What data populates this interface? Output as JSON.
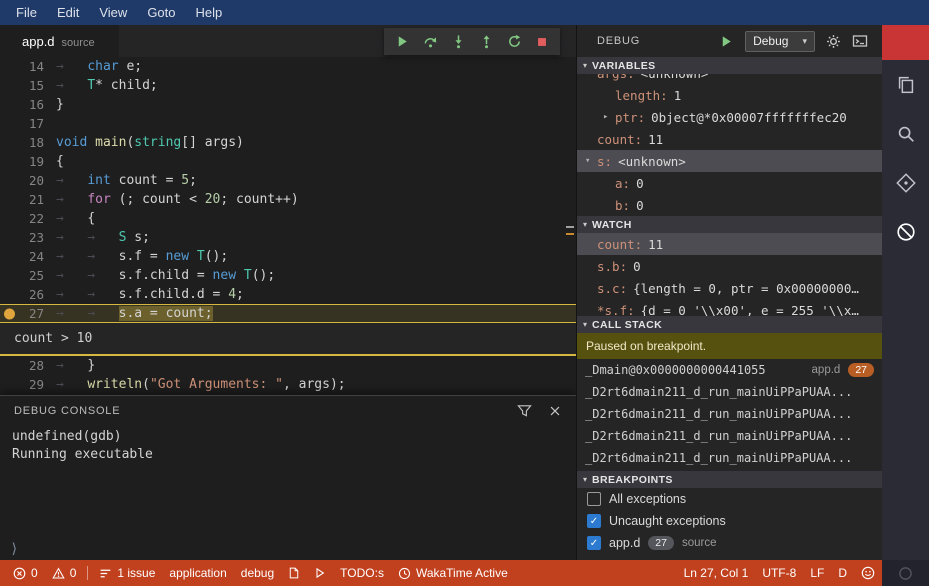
{
  "colors": {
    "menu_bg": "#1f3a68",
    "status_bg": "#c1411f",
    "activity_red": "#c93434",
    "green": "#82c882",
    "red": "#e25d5d",
    "cl_border": "#d4b840",
    "bp_yellow": "#e0a53c",
    "badge_orange": "#b85d24",
    "banner_bg": "#575110",
    "check_blue": "#2d7ad1",
    "sel_bg": "#4c4c52"
  },
  "glyphs": {
    "chevron_down": "▾",
    "twistie_open": "▾",
    "twistie_closed": "▸",
    "check": "✓"
  },
  "menubar": {
    "items": [
      {
        "label": "File"
      },
      {
        "label": "Edit"
      },
      {
        "label": "View"
      },
      {
        "label": "Goto"
      },
      {
        "label": "Help"
      }
    ]
  },
  "editor": {
    "tab": {
      "title": "app.d",
      "subtitle": "source"
    },
    "toolbar": [
      {
        "name": "continue-button",
        "icon": "continue-icon"
      },
      {
        "name": "step-over-button",
        "icon": "step-over-icon"
      },
      {
        "name": "step-into-button",
        "icon": "step-into-icon"
      },
      {
        "name": "step-out-button",
        "icon": "step-out-icon"
      },
      {
        "name": "restart-button",
        "icon": "restart-icon"
      },
      {
        "name": "stop-button",
        "icon": "stop-icon"
      }
    ],
    "breakpoint_widget_text": "count > 10",
    "lines": [
      {
        "n": "14",
        "tokens": [
          {
            "c": "ws",
            "t": "→   "
          },
          {
            "c": "kw",
            "t": "char"
          },
          {
            "c": "d",
            "t": " e;"
          }
        ]
      },
      {
        "n": "15",
        "tokens": [
          {
            "c": "ws",
            "t": "→   "
          },
          {
            "c": "ty",
            "t": "T"
          },
          {
            "c": "d",
            "t": "* child;"
          }
        ]
      },
      {
        "n": "16",
        "tokens": [
          {
            "c": "d",
            "t": "}"
          }
        ]
      },
      {
        "n": "17",
        "tokens": []
      },
      {
        "n": "18",
        "tokens": [
          {
            "c": "kw",
            "t": "void"
          },
          {
            "c": "d",
            "t": " "
          },
          {
            "c": "fn",
            "t": "main"
          },
          {
            "c": "d",
            "t": "("
          },
          {
            "c": "ty",
            "t": "string"
          },
          {
            "c": "d",
            "t": "[] args)"
          }
        ]
      },
      {
        "n": "19",
        "tokens": [
          {
            "c": "d",
            "t": "{"
          }
        ]
      },
      {
        "n": "20",
        "tokens": [
          {
            "c": "ws",
            "t": "→   "
          },
          {
            "c": "kw",
            "t": "int"
          },
          {
            "c": "d",
            "t": " count = "
          },
          {
            "c": "num",
            "t": "5"
          },
          {
            "c": "d",
            "t": ";"
          }
        ]
      },
      {
        "n": "21",
        "tokens": [
          {
            "c": "ws",
            "t": "→   "
          },
          {
            "c": "ctrl",
            "t": "for"
          },
          {
            "c": "d",
            "t": " (; count < "
          },
          {
            "c": "num",
            "t": "20"
          },
          {
            "c": "d",
            "t": "; count++)"
          }
        ]
      },
      {
        "n": "22",
        "tokens": [
          {
            "c": "ws",
            "t": "→   "
          },
          {
            "c": "d",
            "t": "{"
          }
        ]
      },
      {
        "n": "23",
        "tokens": [
          {
            "c": "ws",
            "t": "→   →   "
          },
          {
            "c": "ty",
            "t": "S"
          },
          {
            "c": "d",
            "t": " s;"
          }
        ]
      },
      {
        "n": "24",
        "tokens": [
          {
            "c": "ws",
            "t": "→   →   "
          },
          {
            "c": "d",
            "t": "s.f = "
          },
          {
            "c": "kw",
            "t": "new"
          },
          {
            "c": "d",
            "t": " "
          },
          {
            "c": "ty",
            "t": "T"
          },
          {
            "c": "d",
            "t": "();"
          }
        ]
      },
      {
        "n": "25",
        "tokens": [
          {
            "c": "ws",
            "t": "→   →   "
          },
          {
            "c": "d",
            "t": "s.f.child = "
          },
          {
            "c": "kw",
            "t": "new"
          },
          {
            "c": "d",
            "t": " "
          },
          {
            "c": "ty",
            "t": "T"
          },
          {
            "c": "d",
            "t": "();"
          }
        ]
      },
      {
        "n": "26",
        "tokens": [
          {
            "c": "ws",
            "t": "→   →   "
          },
          {
            "c": "d",
            "t": "s.f.child.d = "
          },
          {
            "c": "num",
            "t": "4"
          },
          {
            "c": "d",
            "t": ";"
          }
        ]
      },
      {
        "n": "27",
        "current": true,
        "breakpoint": true,
        "widget": true,
        "tokens": [
          {
            "c": "ws",
            "t": "→   →   "
          },
          {
            "c": "d",
            "t": "s.a = count;",
            "hl": true
          }
        ]
      },
      {
        "n": "28",
        "tokens": [
          {
            "c": "ws",
            "t": "→   "
          },
          {
            "c": "d",
            "t": "}"
          }
        ]
      },
      {
        "n": "29",
        "tokens": [
          {
            "c": "ws",
            "t": "→   "
          },
          {
            "c": "fn",
            "t": "writeln"
          },
          {
            "c": "d",
            "t": "("
          },
          {
            "c": "str",
            "t": "\"Got Arguments: \""
          },
          {
            "c": "d",
            "t": ", args);"
          }
        ]
      }
    ]
  },
  "debug_console": {
    "title": "DEBUG CONSOLE",
    "lines": [
      "undefined(gdb)",
      "Running executable"
    ],
    "prompt": "⟩"
  },
  "debug_panel": {
    "title": "DEBUG",
    "config": "Debug",
    "variables": {
      "title": "VARIABLES",
      "rows": [
        {
          "label": "args",
          "value": "<unknown>",
          "indent": 1,
          "twistie": "open",
          "clipped": true
        },
        {
          "label": "length",
          "value": "1",
          "indent": 2
        },
        {
          "label": "ptr",
          "value": "0bject@*0x00007fffffffec20",
          "indent": 2,
          "twistie": "closed"
        },
        {
          "label": "count",
          "value": "11",
          "indent": 1
        },
        {
          "label": "s",
          "value": "<unknown>",
          "indent": 1,
          "twistie": "open",
          "selected": true
        },
        {
          "label": "a",
          "value": "0",
          "indent": 2
        },
        {
          "label": "b",
          "value": "0",
          "indent": 2
        }
      ]
    },
    "watch": {
      "title": "WATCH",
      "rows": [
        {
          "label": "count",
          "value": "11",
          "selected": true
        },
        {
          "label": "s.b",
          "value": "0"
        },
        {
          "label": "s.c",
          "value": "{length = 0, ptr = 0x00000000…"
        },
        {
          "label": "*s.f",
          "value": "{d = 0 '\\\\x00', e = 255 '\\\\x…"
        }
      ]
    },
    "call_stack": {
      "title": "CALL STACK",
      "status": "Paused on breakpoint.",
      "frames": [
        {
          "name": "_Dmain@0x0000000000441055",
          "file": "app.d",
          "line": "27"
        },
        {
          "name": "_D2rt6dmain211_d_run_mainUiPPaPUAA..."
        },
        {
          "name": "_D2rt6dmain211_d_run_mainUiPPaPUAA..."
        },
        {
          "name": "_D2rt6dmain211_d_run_mainUiPPaPUAA..."
        },
        {
          "name": "_D2rt6dmain211_d_run_mainUiPPaPUAA..."
        }
      ]
    },
    "breakpoints": {
      "title": "BREAKPOINTS",
      "items": [
        {
          "checked": false,
          "label": "All exceptions"
        },
        {
          "checked": true,
          "label": "Uncaught exceptions"
        },
        {
          "checked": true,
          "label": "app.d",
          "badge": "27",
          "suffix": "source"
        }
      ]
    }
  },
  "status_bar": {
    "left": [
      {
        "icon": "error-icon",
        "label": "0",
        "name": "errors-indicator"
      },
      {
        "icon": "warning-icon",
        "label": "0",
        "name": "warnings-indicator"
      },
      {
        "divider": true
      },
      {
        "icon": "issues-icon",
        "label": "1 issue",
        "name": "issues-indicator"
      },
      {
        "label": "application",
        "name": "application-item"
      },
      {
        "label": "debug",
        "name": "debug-item"
      },
      {
        "icon": "file-icon",
        "name": "file-indicator"
      },
      {
        "icon": "run-icon",
        "name": "run-indicator"
      },
      {
        "label": "TODO:s",
        "name": "todos-item"
      },
      {
        "icon": "clock-icon",
        "label": "WakaTime Active",
        "name": "wakatime-item"
      }
    ],
    "right": [
      {
        "label": "Ln 27, Col 1",
        "name": "cursor-position"
      },
      {
        "label": "UTF-8",
        "name": "encoding-indicator"
      },
      {
        "label": "LF",
        "name": "eol-indicator"
      },
      {
        "label": "D",
        "name": "language-mode"
      },
      {
        "icon": "smiley-icon",
        "name": "feedback-smiley"
      }
    ]
  },
  "activity_bar": {
    "items": [
      {
        "icon": "files-icon",
        "name": "activity-explorer"
      },
      {
        "icon": "search-icon",
        "name": "activity-search"
      },
      {
        "icon": "git-icon",
        "name": "activity-source-control"
      },
      {
        "icon": "debug-icon",
        "name": "activity-debug"
      }
    ]
  }
}
